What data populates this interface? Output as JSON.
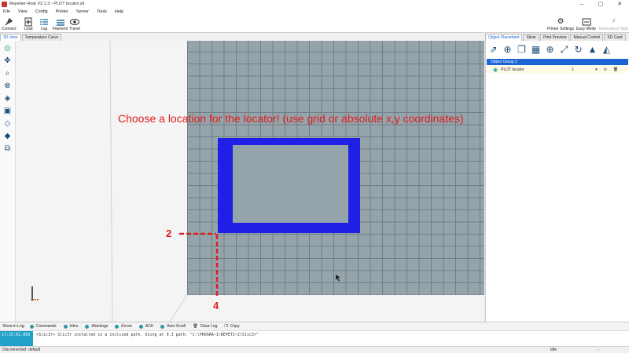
{
  "window": {
    "title": "Repetier-Host V2.1.3 - PLOT locator.stl",
    "minimize": "–",
    "maximize": "▢",
    "close": "✕"
  },
  "menu": [
    "File",
    "View",
    "Config",
    "Printer",
    "Server",
    "Tools",
    "Help"
  ],
  "toolbar": {
    "connect": "Connect",
    "load": "Load",
    "log": "Log",
    "filament": "Filament",
    "travel": "Travel",
    "printer_settings": "Printer Settings",
    "easy_mode": "Easy Mode",
    "emergency_stop": "Emergency Stop"
  },
  "view_tabs": [
    "3D View",
    "Temperature Curve"
  ],
  "right_tabs": [
    "Object Placement",
    "Slicer",
    "Print Preview",
    "Manual Control",
    "SD Card"
  ],
  "object_group": {
    "name": "Object Group 2"
  },
  "object": {
    "name": "PLOT locator",
    "count": "1"
  },
  "annotation": {
    "instruction": "Choose a location for the locator! (use grid or absolute x,y coordinates)",
    "y_value": "2",
    "x_value": "4"
  },
  "log_bar": {
    "show_in_log": "Show in Log:",
    "items": [
      "Commands",
      "Infos",
      "Warnings",
      "Errors",
      "ACK",
      "Auto Scroll",
      "Clear Log",
      "Copy"
    ]
  },
  "log": {
    "time": "17:25:02.893",
    "message": "<Slic3r> Slic3r installed in a inclized path. Using at 0.3 path: \"C:\\PROGRA~1\\REPETI~2\\Slic3r\""
  },
  "status": {
    "left": "Disconnected: default",
    "right_a": "Idle",
    "right_b": "-"
  },
  "colors": {
    "accent": "#1a64d6",
    "object": "#1f1fe6",
    "annotation": "#e01c1c",
    "bed": "#95a4ab"
  }
}
